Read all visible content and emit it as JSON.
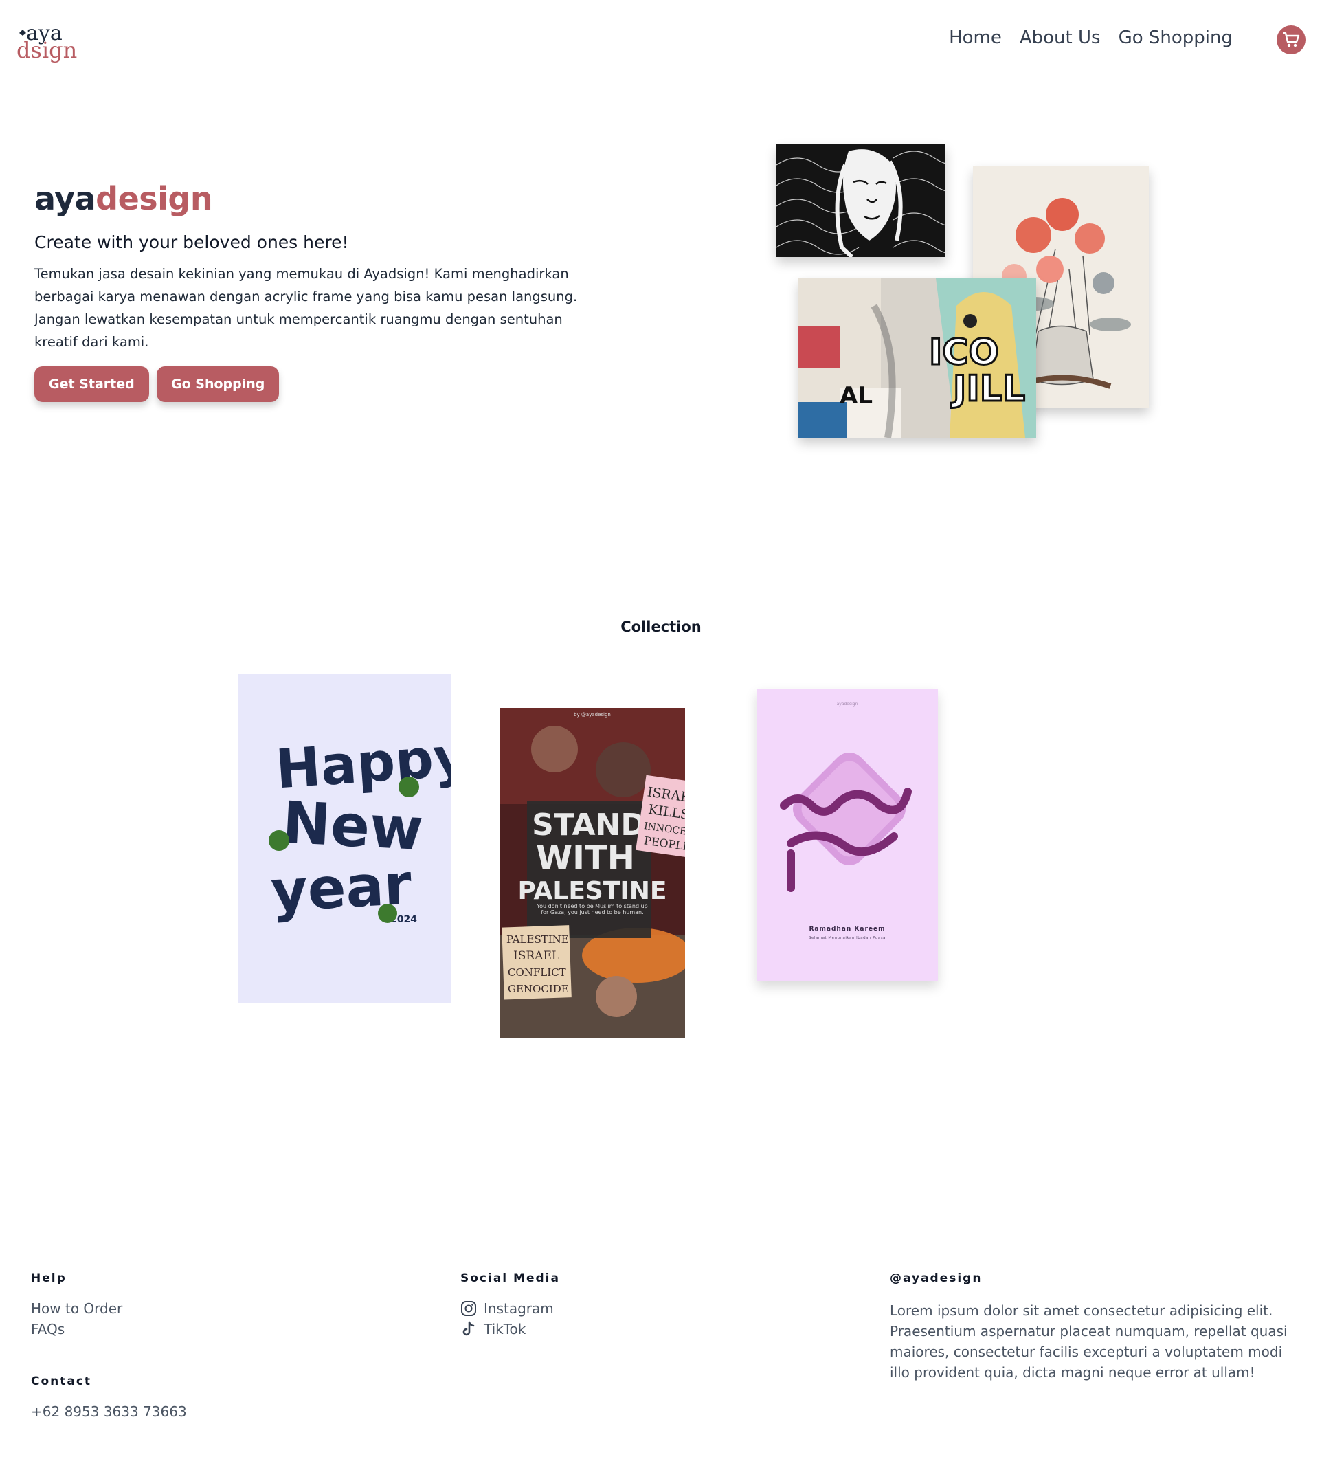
{
  "brand": {
    "logo_top": "aya",
    "logo_bottom": "dsign",
    "accent_color": "#b85c62",
    "dark_color": "#1e293b"
  },
  "nav": {
    "links": [
      {
        "label": "Home"
      },
      {
        "label": "About Us"
      },
      {
        "label": "Go Shopping"
      }
    ],
    "cart_icon": "shopping-cart-icon"
  },
  "hero": {
    "title_part1": "aya",
    "title_part2": "design",
    "subtitle": "Create with your beloved ones here!",
    "description": "Temukan jasa desain kekinian yang memukau di Ayadsign! Kami menghadirkan berbagai karya menawan dengan acrylic frame yang bisa kamu pesan langsung. Jangan lewatkan kesempatan untuk mempercantik ruangmu dengan sentuhan kreatif dari kami.",
    "buttons": {
      "primary": "Get Started",
      "secondary": "Go Shopping"
    }
  },
  "collection": {
    "title": "Collection",
    "items": [
      {
        "lines": [
          "Happy",
          "New",
          "year"
        ],
        "year": "2024"
      },
      {
        "top_text": "by @ayadesign",
        "headline": [
          "STAND",
          "WITH",
          "PALESTINE"
        ],
        "caption": "You don't need to be Muslim to stand up for Gaza, you just need to be human.",
        "sign1": [
          "ISRAEL",
          "KILLS",
          "INNOCENT",
          "PEOPLE"
        ],
        "sign2": [
          "PALESTINE",
          "ISRAEL",
          "CONFLICT",
          "GENOCIDE"
        ]
      },
      {
        "top_text": "ayadesign",
        "title": "Ramadhan Kareem",
        "subtitle": "Selamat Menunaikan Ibadah Puasa"
      }
    ]
  },
  "footer": {
    "help": {
      "heading": "Help",
      "links": [
        "How to Order",
        "FAQs"
      ]
    },
    "contact": {
      "heading": "Contact",
      "phone": "+62 8953 3633 73663"
    },
    "social": {
      "heading": "Social Media",
      "links": [
        {
          "label": "Instagram",
          "icon": "instagram-icon"
        },
        {
          "label": "TikTok",
          "icon": "tiktok-icon"
        }
      ]
    },
    "about": {
      "heading": "@ayadesign",
      "text": "Lorem ipsum dolor sit amet consectetur adipisicing elit. Praesentium aspernatur placeat numquam, repellat quasi maiores, consectetur facilis excepturi a voluptatem modi illo provident quia, dicta magni neque error at ullam!"
    }
  }
}
